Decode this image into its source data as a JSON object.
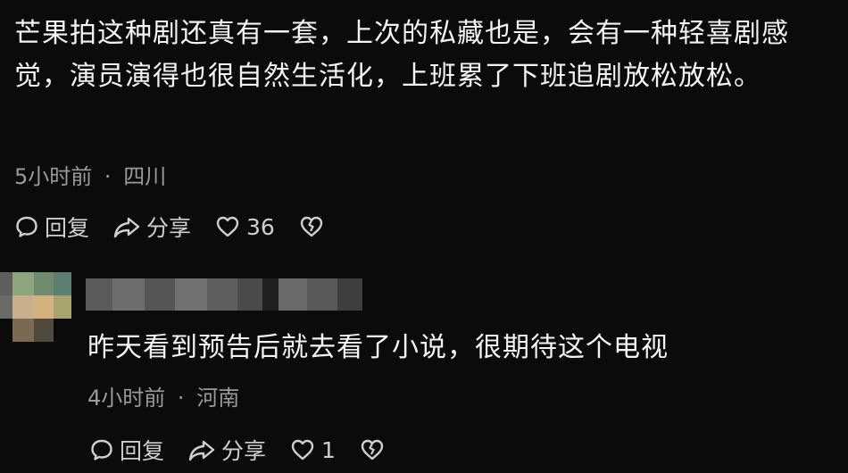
{
  "comment1": {
    "text": "芒果拍这种剧还真有一套，上次的私藏也是，会有一种轻喜剧感觉，演员演得也很自然生活化，上班累了下班追剧放松放松。",
    "time": "5小时前",
    "location": "四川",
    "reply_label": "回复",
    "share_label": "分享",
    "like_count": "36"
  },
  "comment2": {
    "text": "昨天看到预告后就去看了小说，很期待这个电视",
    "time": "4小时前",
    "location": "河南",
    "reply_label": "回复",
    "share_label": "分享",
    "like_count": "1"
  },
  "separator": "·",
  "colors": {
    "background": "#0b0b0b",
    "text": "#f4f4f4",
    "meta": "#9a9a9a",
    "icon": "#cfcfcf"
  }
}
